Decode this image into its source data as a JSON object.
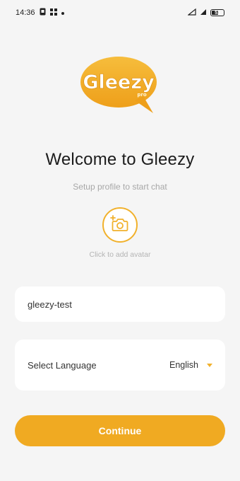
{
  "status_bar": {
    "time": "14:36",
    "left_icons": [
      "sim-icon",
      "grid-icon",
      "dot-icon"
    ],
    "right_icons": [
      "signal-icon",
      "wifi-icon"
    ],
    "battery_level": "53"
  },
  "logo": {
    "text": "Gleezy",
    "sub": "pro",
    "brand_color": "#f0aa22"
  },
  "welcome": {
    "title": "Welcome to Gleezy",
    "subtitle": "Setup profile to start chat"
  },
  "avatar": {
    "hint": "Click to add avatar",
    "icon": "camera-add-icon"
  },
  "form": {
    "name_value": "gleezy-test",
    "language_label": "Select Language",
    "language_value": "English",
    "continue_label": "Continue"
  },
  "colors": {
    "accent": "#f0aa22",
    "background": "#f5f5f5",
    "card": "#ffffff"
  }
}
